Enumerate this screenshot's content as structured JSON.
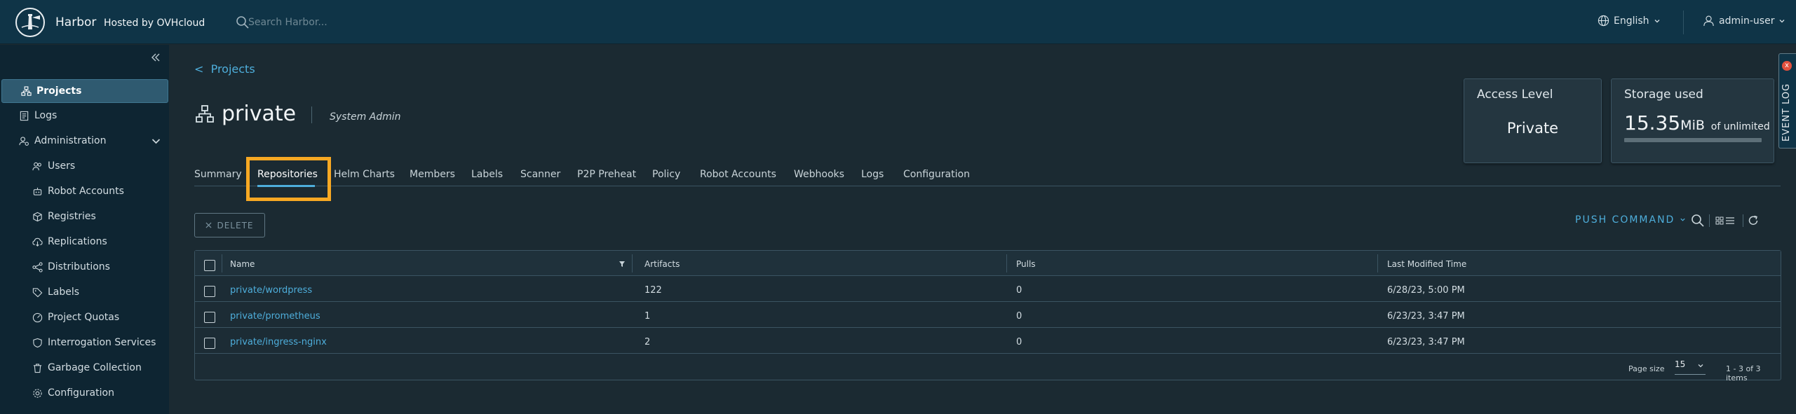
{
  "header": {
    "brand": "Harbor",
    "hosted_by": "Hosted by OVHcloud",
    "search_placeholder": "Search Harbor...",
    "language": "English",
    "user": "admin-user"
  },
  "sidebar": {
    "items": [
      {
        "label": "Projects",
        "icon": "projects-icon",
        "active": true
      },
      {
        "label": "Logs",
        "icon": "logs-icon"
      },
      {
        "label": "Administration",
        "icon": "administration-icon",
        "expanded": true
      }
    ],
    "admin_items": [
      {
        "label": "Users",
        "icon": "users-icon"
      },
      {
        "label": "Robot Accounts",
        "icon": "robot-icon"
      },
      {
        "label": "Registries",
        "icon": "registries-icon"
      },
      {
        "label": "Replications",
        "icon": "replications-icon"
      },
      {
        "label": "Distributions",
        "icon": "distributions-icon"
      },
      {
        "label": "Labels",
        "icon": "labels-icon"
      },
      {
        "label": "Project Quotas",
        "icon": "quotas-icon"
      },
      {
        "label": "Interrogation Services",
        "icon": "interrogation-icon"
      },
      {
        "label": "Garbage Collection",
        "icon": "trash-icon"
      },
      {
        "label": "Configuration",
        "icon": "gear-icon"
      }
    ]
  },
  "breadcrumb": "Projects",
  "project": {
    "name": "private",
    "role": "System Admin"
  },
  "access_card": {
    "label": "Access Level",
    "value": "Private"
  },
  "storage_card": {
    "label": "Storage used",
    "value": "15.35",
    "unit": "MiB",
    "suffix": "of unlimited",
    "fill": 0
  },
  "event_log": {
    "label": "EVENT LOG",
    "badge": "x"
  },
  "tabs": [
    {
      "label": "Summary"
    },
    {
      "label": "Repositories",
      "active": true
    },
    {
      "label": "Helm Charts"
    },
    {
      "label": "Members"
    },
    {
      "label": "Labels"
    },
    {
      "label": "Scanner"
    },
    {
      "label": "P2P Preheat"
    },
    {
      "label": "Policy"
    },
    {
      "label": "Robot Accounts"
    },
    {
      "label": "Webhooks"
    },
    {
      "label": "Logs"
    },
    {
      "label": "Configuration"
    }
  ],
  "toolbar": {
    "delete_label": "DELETE",
    "push_command_label": "PUSH COMMAND"
  },
  "table": {
    "columns": [
      "Name",
      "Artifacts",
      "Pulls",
      "Last Modified Time"
    ],
    "rows": [
      {
        "name": "private/wordpress",
        "artifacts": "122",
        "pulls": "0",
        "modified": "6/28/23, 5:00 PM"
      },
      {
        "name": "private/prometheus",
        "artifacts": "1",
        "pulls": "0",
        "modified": "6/23/23, 3:47 PM"
      },
      {
        "name": "private/ingress-nginx",
        "artifacts": "2",
        "pulls": "0",
        "modified": "6/23/23, 3:47 PM"
      }
    ],
    "page_size_label": "Page size",
    "page_size": "15",
    "count_text": "1 - 3 of 3 items"
  },
  "colors": {
    "header_bg": "#0f3447",
    "sidebar_bg": "#0e2532",
    "content_bg": "#1b2a32",
    "accent": "#4eaedb",
    "highlight": "#f7a823"
  }
}
